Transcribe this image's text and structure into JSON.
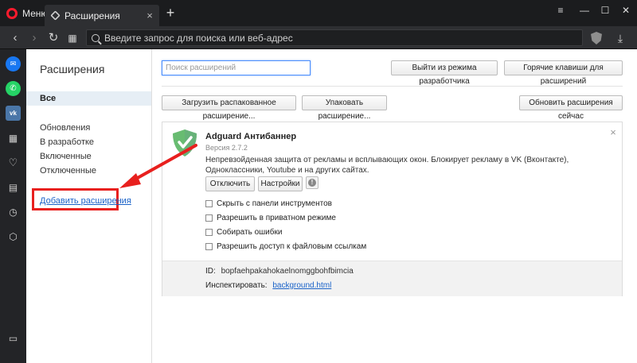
{
  "browser": {
    "menu_label": "Меню",
    "tab_title": "Расширения",
    "new_tab": "+",
    "address_placeholder": "Введите запрос для поиска или веб-адрес"
  },
  "sidebar": {
    "title": "Расширения",
    "nav_all": "Все",
    "items": [
      {
        "label": "Обновления"
      },
      {
        "label": "В разработке"
      },
      {
        "label": "Включенные"
      },
      {
        "label": "Отключенные"
      }
    ],
    "add_link": "Добавить расширения"
  },
  "toolbar": {
    "search_placeholder": "Поиск расширений",
    "exit_dev_label": "Выйти из режима разработчика",
    "hotkeys_label": "Горячие клавиши для расширений",
    "load_unpacked_label": "Загрузить распакованное расширение...",
    "pack_label": "Упаковать расширение...",
    "update_label": "Обновить расширения сейчас"
  },
  "extension": {
    "name": "Adguard Антибаннер",
    "version": "Версия 2.7.2",
    "description": "Непревзойденная защита от рекламы и всплывающих окон. Блокирует рекламу в VK (Вконтакте), Одноклассники, Youtube и на других сайтах.",
    "disable_label": "Отключить",
    "settings_label": "Настройки",
    "info_glyph": "!",
    "close_glyph": "×",
    "options": [
      {
        "label": "Скрыть с панели инструментов",
        "checked": false
      },
      {
        "label": "Разрешить в приватном режиме",
        "checked": false
      },
      {
        "label": "Собирать ошибки",
        "checked": false
      },
      {
        "label": "Разрешить доступ к файловым ссылкам",
        "checked": false
      }
    ],
    "id_label": "ID:",
    "id_value": "bopfaehpakahokaelnomggbohfbimcia",
    "inspect_label": "Инспектировать:",
    "inspect_link": "background.html"
  },
  "colors": {
    "accent_red": "#e8201e",
    "link_blue": "#1a62c8",
    "adguard_green": "#68bc71"
  }
}
